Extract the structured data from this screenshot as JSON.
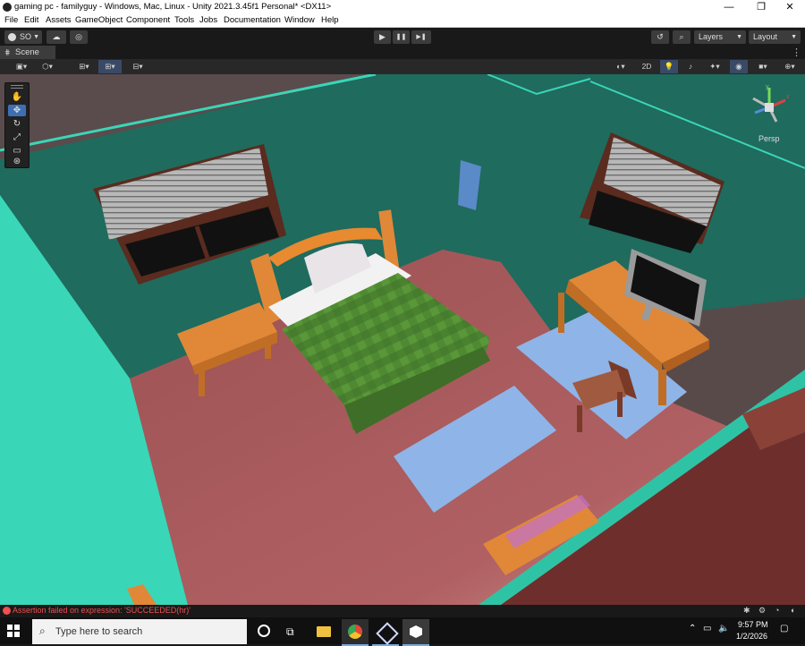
{
  "window": {
    "title": "gaming pc - familyguy - Windows, Mac, Linux - Unity 2021.3.45f1 Personal* <DX11>",
    "min_glyph": "—",
    "restore_glyph": "❐",
    "close_glyph": "✕"
  },
  "menu": [
    "File",
    "Edit",
    "Assets",
    "GameObject",
    "Component",
    "Tools",
    "Jobs",
    "Documentation",
    "Window",
    "Help"
  ],
  "toolbar": {
    "account_label": "SO",
    "layers_label": "Layers",
    "layout_label": "Layout",
    "play_glyph": "▶",
    "pause_glyph": "❚❚",
    "step_glyph": "▶❚"
  },
  "scene_tab": {
    "label": "Scene",
    "menu_glyph": "⋮"
  },
  "scene_toolbar": {
    "mode_2d": "2D"
  },
  "gizmo": {
    "persp_label": "Persp"
  },
  "status": {
    "message": "Assertion failed on expression: 'SUCCEEDED(hr)'"
  },
  "taskbar": {
    "search_placeholder": "Type here to search",
    "time": "9:57 PM",
    "date": "1/2/2026"
  },
  "colors": {
    "wall": "#1f6b5e",
    "floor": "#a8585a",
    "cyan_wall": "#3ad6b8",
    "desk": "#e08838",
    "rug": "#8fb4e8",
    "bed_cover": "#4f8a33",
    "unity_accent": "#3e6fb3",
    "error": "#f05050"
  }
}
